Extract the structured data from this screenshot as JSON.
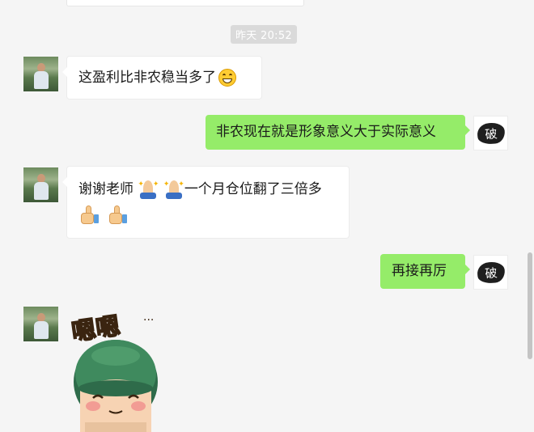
{
  "timestamp": "昨天 20:52",
  "messages": [
    {
      "side": "in",
      "text": "这盈利比非农稳当多了",
      "emoji": "grin-emoji"
    },
    {
      "side": "out",
      "text": "非农现在就是形象意义大于实际意义"
    },
    {
      "side": "in",
      "text": "谢谢老师",
      "text2": "一个月仓位翻了三倍多",
      "emoji": "pray-emoji",
      "emoji2": "thumbs-up-emoji"
    },
    {
      "side": "out",
      "text": "再接再厉"
    },
    {
      "side": "in",
      "sticker": "嗯嗯..."
    }
  ],
  "self_avatar_glyph": "破",
  "sticker_text": "嗯嗯",
  "sticker_dots": "···",
  "colors": {
    "background": "#f5f5f5",
    "outgoing_bubble": "#95ec69",
    "incoming_bubble": "#ffffff",
    "timestamp_bg": "#dadada"
  }
}
